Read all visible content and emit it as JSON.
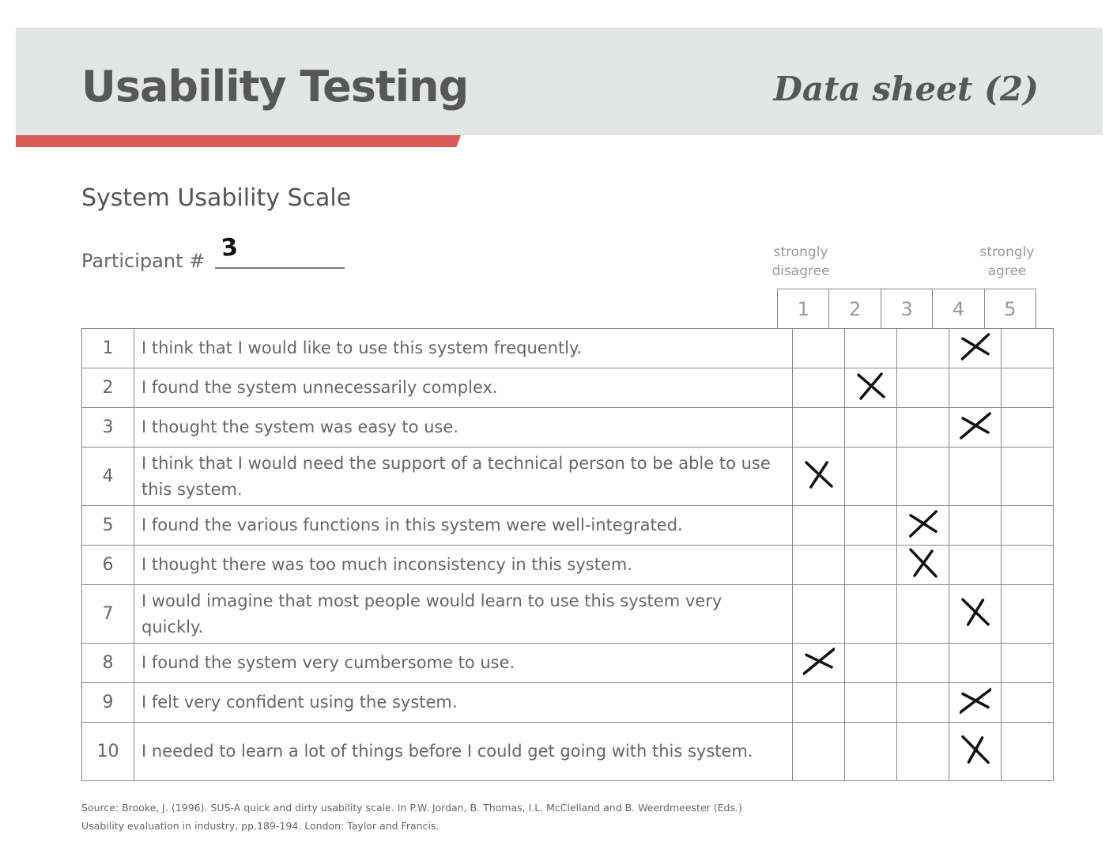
{
  "header": {
    "title": "Usability Testing",
    "sheet_label": "Data sheet (2)"
  },
  "colors": {
    "header_band": "#e2e7e6",
    "accent_bar": "#dc5a55",
    "mark_ink": "#111111"
  },
  "section": {
    "title": "System Usability Scale"
  },
  "participant": {
    "label": "Participant #",
    "value": "3"
  },
  "scale": {
    "left_anchor_line1": "strongly",
    "left_anchor_line2": "disagree",
    "right_anchor_line1": "strongly",
    "right_anchor_line2": "agree",
    "options": [
      "1",
      "2",
      "3",
      "4",
      "5"
    ]
  },
  "items": [
    {
      "number": "1",
      "text": "I think that I would like to use this system frequently.",
      "response": 4
    },
    {
      "number": "2",
      "text": "I found the system unnecessarily complex.",
      "response": 2
    },
    {
      "number": "3",
      "text": "I thought the system was easy to use.",
      "response": 4
    },
    {
      "number": "4",
      "text": "I think that I would need the support of a technical person to be able to use this system.",
      "response": 1
    },
    {
      "number": "5",
      "text": "I found the various functions in this system were well-integrated.",
      "response": 3
    },
    {
      "number": "6",
      "text": "I thought there was too much inconsistency in this system.",
      "response": 3
    },
    {
      "number": "7",
      "text": "I would imagine that most people would learn to use this system very quickly.",
      "response": 4
    },
    {
      "number": "8",
      "text": "I found the system very cumbersome to use.",
      "response": 1
    },
    {
      "number": "9",
      "text": "I felt very confident using the system.",
      "response": 4
    },
    {
      "number": "10",
      "text": "I needed to learn a lot of things before I could get going with this system.",
      "response": 4
    }
  ],
  "source": {
    "line1": "Source: Brooke, J. (1996). SUS-A quick and dirty usability scale. In P.W. Jordan, B. Thomas, I.L. McClelland and B. Weerdmeester (Eds.)",
    "line2": "Usability evaluation in industry, pp.189-194. London: Taylor and Francis."
  }
}
